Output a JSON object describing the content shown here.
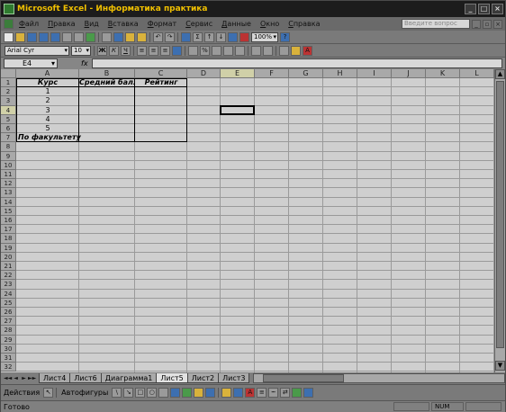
{
  "window": {
    "title": "Microsoft Excel - Информатика практика",
    "controls": [
      "_",
      "□",
      "×"
    ]
  },
  "menu": {
    "items": [
      "Файл",
      "Правка",
      "Вид",
      "Вставка",
      "Формат",
      "Сервис",
      "Данные",
      "Окно",
      "Справка"
    ],
    "help_placeholder": "Введите вопрос"
  },
  "toolbar": {
    "zoom": "100%"
  },
  "format_toolbar": {
    "font": "Arial Cyr",
    "size": "10",
    "bold": "Ж",
    "italic": "К",
    "underline": "Ч"
  },
  "formula_bar": {
    "name_box": "E4",
    "fx": "fx",
    "value": ""
  },
  "sheet": {
    "columns": [
      "A",
      "B",
      "C",
      "D",
      "E",
      "F",
      "G",
      "H",
      "I",
      "J",
      "K",
      "L"
    ],
    "selected_column": "E",
    "rows": [
      "1",
      "2",
      "3",
      "4",
      "5",
      "6",
      "7",
      "8",
      "9",
      "10",
      "11",
      "12",
      "13",
      "14",
      "15",
      "16",
      "17",
      "18",
      "19",
      "20",
      "21",
      "22",
      "23",
      "24",
      "25",
      "26",
      "27",
      "28",
      "29",
      "30",
      "31",
      "32"
    ],
    "selected_row": "4",
    "headers": {
      "a1": "Курс",
      "b1": "Средний балл",
      "c1": "Рейтинг"
    },
    "courses": [
      "1",
      "2",
      "3",
      "4",
      "5"
    ],
    "a7": "По факультету"
  },
  "tabs": {
    "nav": [
      "◄◄",
      "◄",
      "►",
      "►►"
    ],
    "items": [
      "Лист4",
      "Лист6",
      "Диаграмма1",
      "Лист5",
      "Лист2",
      "Лист3"
    ],
    "active": "Лист5"
  },
  "drawing": {
    "actions": "Действия",
    "autoshapes": "Автофигуры"
  },
  "status": {
    "text": "Готово",
    "num": "NUM"
  }
}
